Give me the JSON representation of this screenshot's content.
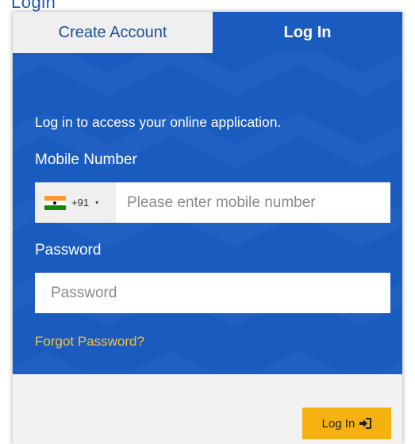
{
  "colors": {
    "panel_blue": "#1a5bbf",
    "tab_inactive_bg": "#efefef",
    "tab_inactive_text": "#1d4f96",
    "link_yellow": "#f5c230",
    "button_yellow": "#f5b10f"
  },
  "header": {
    "partial_title": "Login"
  },
  "tabs": [
    {
      "label": "Create Account",
      "active": false
    },
    {
      "label": "Log In",
      "active": true
    }
  ],
  "login_form": {
    "intro": "Log in to access your online application.",
    "mobile_label": "Mobile Number",
    "country": {
      "flag_icon": "india-flag-icon",
      "dial_code": "+91",
      "caret": "▾"
    },
    "mobile_placeholder": "Please enter mobile number",
    "mobile_value": "",
    "password_label": "Password",
    "password_placeholder": "Password",
    "password_value": "",
    "forgot_link": "Forgot Password?",
    "submit_label": "Log In",
    "submit_icon": "sign-in-icon"
  }
}
